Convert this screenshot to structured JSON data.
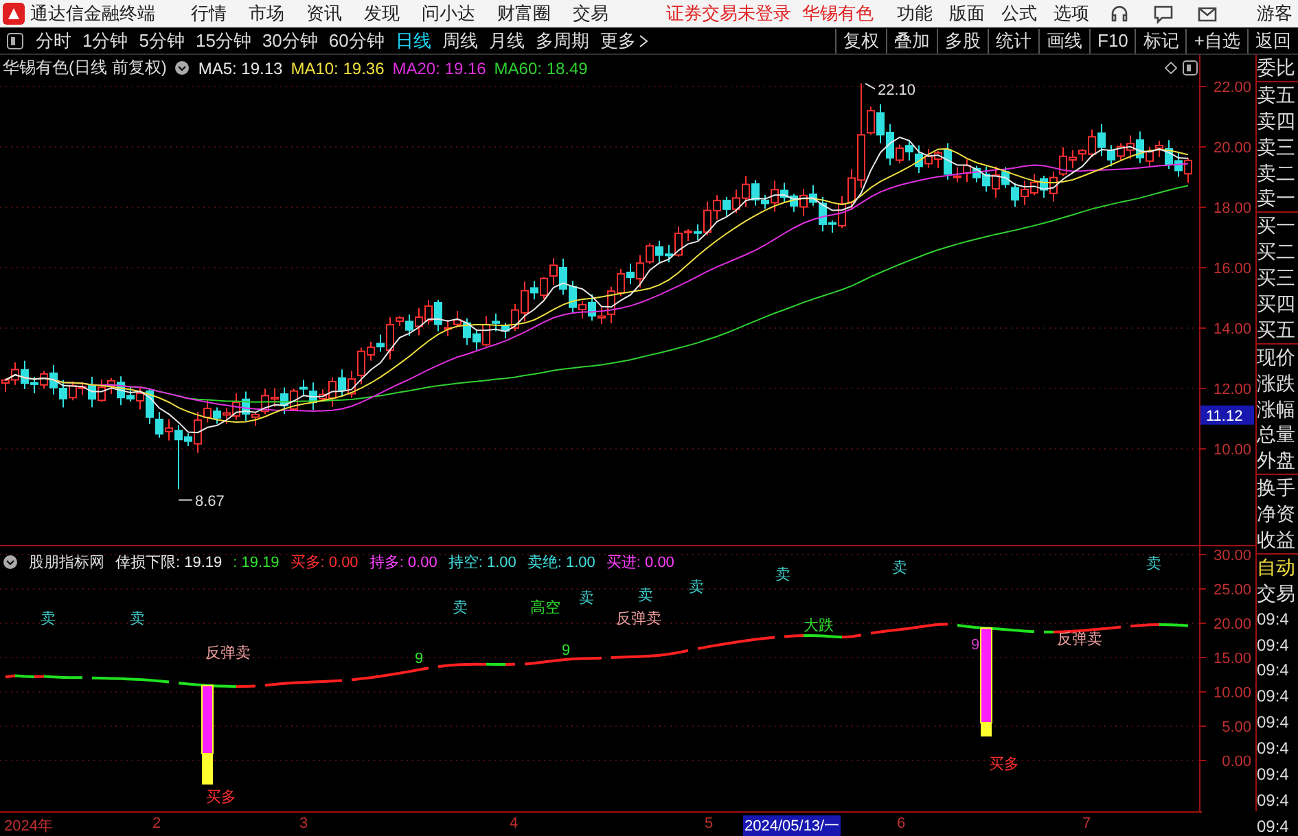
{
  "menubar": {
    "app_title": "通达信金融终端",
    "menus": [
      "行情",
      "市场",
      "资讯",
      "发现",
      "问小达",
      "财富圈",
      "交易"
    ],
    "notice": "证券交易未登录",
    "stock_name": "华锡有色",
    "tools": [
      "功能",
      "版面",
      "公式",
      "选项"
    ],
    "user": "游客"
  },
  "toolbar": {
    "periods": [
      {
        "label": "分时",
        "selected": false
      },
      {
        "label": "1分钟",
        "selected": false
      },
      {
        "label": "5分钟",
        "selected": false
      },
      {
        "label": "15分钟",
        "selected": false
      },
      {
        "label": "30分钟",
        "selected": false
      },
      {
        "label": "60分钟",
        "selected": false
      },
      {
        "label": "日线",
        "selected": true
      },
      {
        "label": "周线",
        "selected": false
      },
      {
        "label": "月线",
        "selected": false
      },
      {
        "label": "多周期",
        "selected": false
      }
    ],
    "more": "更多",
    "actions": [
      "复权",
      "叠加",
      "多股",
      "统计",
      "画线",
      "F10",
      "标记",
      "+自选",
      "返回"
    ]
  },
  "price_chart": {
    "title": "华锡有色(日线 前复权)",
    "ma": [
      {
        "label": "MA5: 19.13",
        "color": "#e8e8e8"
      },
      {
        "label": "MA10: 19.36",
        "color": "#f0e040"
      },
      {
        "label": "MA20: 19.16",
        "color": "#e030e0"
      },
      {
        "label": "MA60: 18.49",
        "color": "#30d030"
      }
    ],
    "yticks": [
      "22.00",
      "20.00",
      "18.00",
      "16.00",
      "14.00",
      "12.00",
      "10.00"
    ],
    "price_tag": "11.12",
    "high_label": "22.10",
    "low_label": "8.67"
  },
  "indicator": {
    "name": "股朋指标网",
    "values": [
      {
        "text": "倖损下限: 19.19",
        "color": "#e8e8e8"
      },
      {
        "text": ": 19.19",
        "color": "#30e030"
      },
      {
        "text": "买多: 0.00",
        "color": "#ff3030"
      },
      {
        "text": "持多: 0.00",
        "color": "#ff40ff"
      },
      {
        "text": "持空: 1.00",
        "color": "#40e0e0"
      },
      {
        "text": "卖绝: 1.00",
        "color": "#40e0e0"
      },
      {
        "text": "买进: 0.00",
        "color": "#ff40ff"
      }
    ],
    "yticks": [
      "30.00",
      "25.00",
      "20.00",
      "15.00",
      "10.00",
      "5.00",
      "0.00"
    ],
    "signals": [
      {
        "text": "卖",
        "kind": "sell"
      },
      {
        "text": "卖",
        "kind": "sell"
      },
      {
        "text": "卖",
        "kind": "sell"
      },
      {
        "text": "高空",
        "kind": "warn"
      },
      {
        "text": "卖",
        "kind": "sell"
      },
      {
        "text": "卖",
        "kind": "sell"
      },
      {
        "text": "卖",
        "kind": "sell"
      },
      {
        "text": "卖",
        "kind": "sell"
      },
      {
        "text": "卖",
        "kind": "sell"
      },
      {
        "text": "卖",
        "kind": "sell"
      },
      {
        "text": "反弹卖",
        "kind": "rebound"
      },
      {
        "text": "反弹卖",
        "kind": "rebound"
      },
      {
        "text": "反弹卖",
        "kind": "rebound"
      },
      {
        "text": "大跌",
        "kind": "warn"
      },
      {
        "text": "9",
        "kind": "count"
      },
      {
        "text": "9",
        "kind": "count"
      },
      {
        "text": "9",
        "kind": "mark"
      },
      {
        "text": "买多",
        "kind": "buy"
      },
      {
        "text": "买多",
        "kind": "buy"
      }
    ]
  },
  "time_axis": [
    {
      "label": "2024年",
      "highlighted": false
    },
    {
      "label": "2",
      "highlighted": false
    },
    {
      "label": "3",
      "highlighted": false
    },
    {
      "label": "4",
      "highlighted": false
    },
    {
      "label": "5",
      "highlighted": false
    },
    {
      "label": "2024/05/13/一",
      "highlighted": true
    },
    {
      "label": "6",
      "highlighted": false
    },
    {
      "label": "7",
      "highlighted": false
    }
  ],
  "side_panel": {
    "quote_labels": [
      "委比",
      "卖五",
      "卖四",
      "卖三",
      "卖二",
      "卖一",
      "买一",
      "买二",
      "买三",
      "买四",
      "买五",
      "现价",
      "涨跌",
      "涨幅",
      "总量",
      "外盘",
      "换手",
      "净资",
      "收益"
    ],
    "mode": "自动",
    "trade": "交易",
    "times": [
      "09:4",
      "09:4",
      "09:4",
      "09:4",
      "09:4",
      "09:4",
      "09:4",
      "09:4",
      "09:4"
    ]
  }
}
